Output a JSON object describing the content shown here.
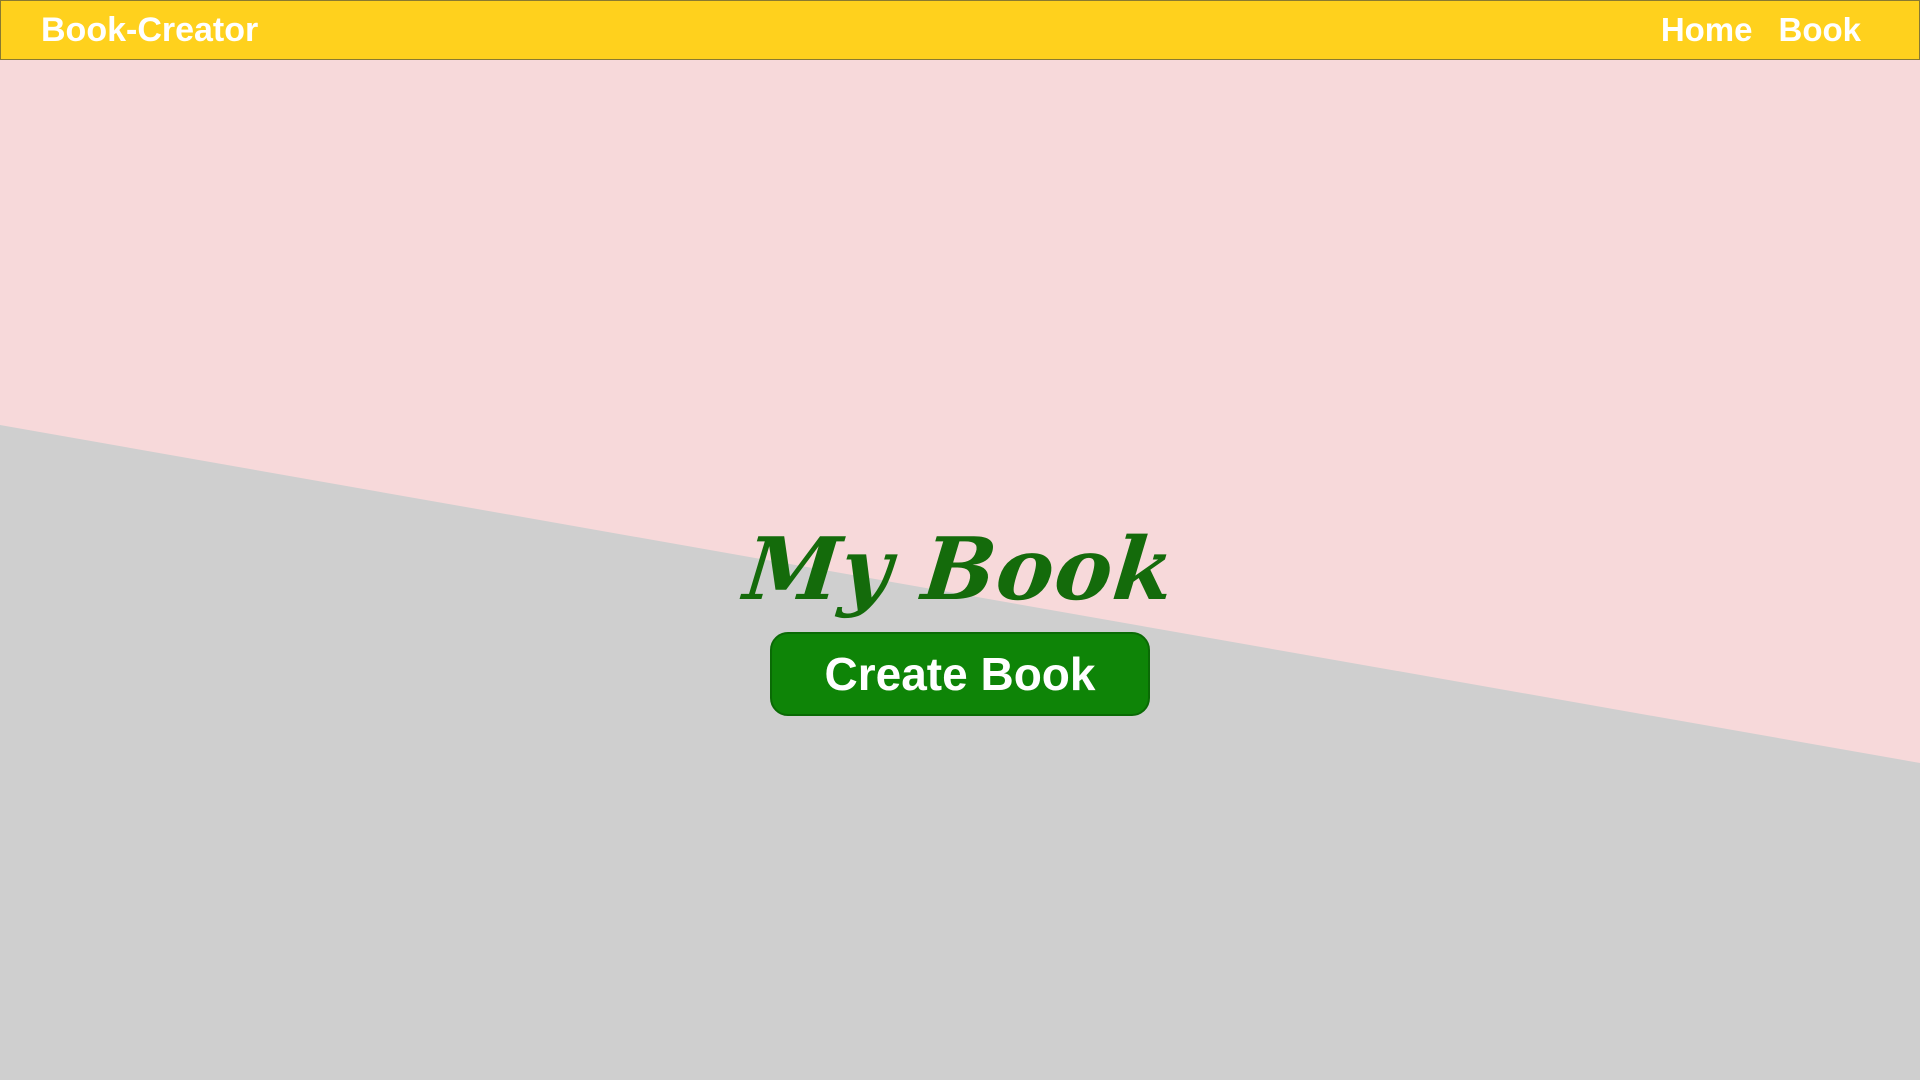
{
  "colors": {
    "navbar_bg": "#ffd11d",
    "upper_bg": "#f7d9da",
    "lower_bg": "#cfcfcf",
    "title_color": "#146b0b",
    "button_bg": "#0e8407",
    "text_light": "#ffffff"
  },
  "navbar": {
    "brand": "Book-Creator",
    "links": [
      {
        "label": "Home"
      },
      {
        "label": "Book"
      }
    ]
  },
  "hero": {
    "title": "My Book",
    "button_label": "Create Book"
  }
}
